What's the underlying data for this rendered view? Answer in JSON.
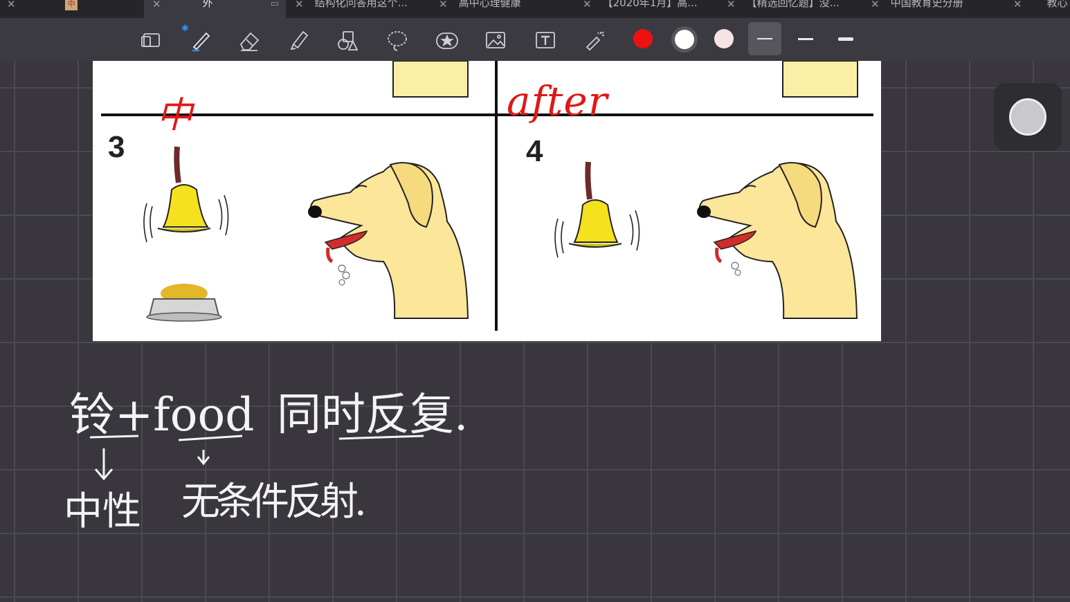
{
  "tabs": [
    {
      "label": "中",
      "active": false
    },
    {
      "label": "外",
      "active": true
    },
    {
      "label": "结构化问答用这个...",
      "active": false
    },
    {
      "label": "高中心理健康",
      "active": false
    },
    {
      "label": "【2020年1月】高...",
      "active": false
    },
    {
      "label": "【精选回忆题】没...",
      "active": false
    },
    {
      "label": "中国教育史分册",
      "active": false
    },
    {
      "label": "教心",
      "active": false
    }
  ],
  "toolbar": {
    "tools": [
      "page-layout-icon",
      "pen-icon",
      "eraser-icon",
      "highlighter-icon",
      "shapes-icon",
      "lasso-icon",
      "sticker-icon",
      "image-icon",
      "text-icon",
      "laser-pointer-icon"
    ],
    "colors": [
      "#ee1111",
      "#ffffff",
      "#f7e3e3"
    ],
    "line_widths": [
      "thin",
      "medium",
      "thick"
    ]
  },
  "panel": {
    "label_3": "3",
    "label_4": "4",
    "red_note_left": "中",
    "red_note_right": "after"
  },
  "notes": {
    "line1_a": "铃+food",
    "line1_b": "同时反复.",
    "line2_a": "中性",
    "line2_b": "无条件反射."
  }
}
